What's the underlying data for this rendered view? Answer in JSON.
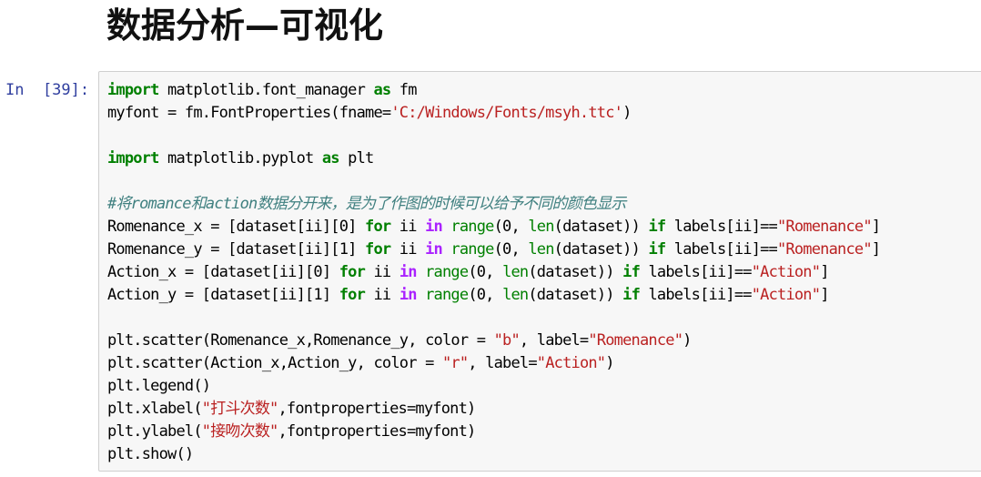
{
  "markdown": {
    "heading": "数据分析—可视化"
  },
  "cell": {
    "prompt": "In  [39]:",
    "lines": [
      [
        {
          "t": "import",
          "c": "kw"
        },
        {
          "t": " matplotlib.font_manager ",
          "c": "tx"
        },
        {
          "t": "as",
          "c": "kw"
        },
        {
          "t": " fm",
          "c": "tx"
        }
      ],
      [
        {
          "t": "myfont = fm.FontProperties(fname=",
          "c": "tx"
        },
        {
          "t": "'C:/Windows/Fonts/msyh.ttc'",
          "c": "str"
        },
        {
          "t": ")",
          "c": "tx"
        }
      ],
      [],
      [
        {
          "t": "import",
          "c": "kw"
        },
        {
          "t": " matplotlib.pyplot ",
          "c": "tx"
        },
        {
          "t": "as",
          "c": "kw"
        },
        {
          "t": " plt",
          "c": "tx"
        }
      ],
      [],
      [
        {
          "t": "#将romance和action数据分开来，是为了作图的时候可以给予不同的颜色显示",
          "c": "cm"
        }
      ],
      [
        {
          "t": "Romenance_x = [dataset[ii][0] ",
          "c": "tx"
        },
        {
          "t": "for",
          "c": "kw"
        },
        {
          "t": " ii ",
          "c": "tx"
        },
        {
          "t": "in",
          "c": "op"
        },
        {
          "t": " ",
          "c": "tx"
        },
        {
          "t": "range",
          "c": "bi"
        },
        {
          "t": "(0, ",
          "c": "tx"
        },
        {
          "t": "len",
          "c": "bi"
        },
        {
          "t": "(dataset)) ",
          "c": "tx"
        },
        {
          "t": "if",
          "c": "kw"
        },
        {
          "t": " labels[ii]==",
          "c": "tx"
        },
        {
          "t": "\"Romenance\"",
          "c": "str"
        },
        {
          "t": "]",
          "c": "tx"
        }
      ],
      [
        {
          "t": "Romenance_y = [dataset[ii][1] ",
          "c": "tx"
        },
        {
          "t": "for",
          "c": "kw"
        },
        {
          "t": " ii ",
          "c": "tx"
        },
        {
          "t": "in",
          "c": "op"
        },
        {
          "t": " ",
          "c": "tx"
        },
        {
          "t": "range",
          "c": "bi"
        },
        {
          "t": "(0, ",
          "c": "tx"
        },
        {
          "t": "len",
          "c": "bi"
        },
        {
          "t": "(dataset)) ",
          "c": "tx"
        },
        {
          "t": "if",
          "c": "kw"
        },
        {
          "t": " labels[ii]==",
          "c": "tx"
        },
        {
          "t": "\"Romenance\"",
          "c": "str"
        },
        {
          "t": "]",
          "c": "tx"
        }
      ],
      [
        {
          "t": "Action_x = [dataset[ii][0] ",
          "c": "tx"
        },
        {
          "t": "for",
          "c": "kw"
        },
        {
          "t": " ii ",
          "c": "tx"
        },
        {
          "t": "in",
          "c": "op"
        },
        {
          "t": " ",
          "c": "tx"
        },
        {
          "t": "range",
          "c": "bi"
        },
        {
          "t": "(0, ",
          "c": "tx"
        },
        {
          "t": "len",
          "c": "bi"
        },
        {
          "t": "(dataset)) ",
          "c": "tx"
        },
        {
          "t": "if",
          "c": "kw"
        },
        {
          "t": " labels[ii]==",
          "c": "tx"
        },
        {
          "t": "\"Action\"",
          "c": "str"
        },
        {
          "t": "]",
          "c": "tx"
        }
      ],
      [
        {
          "t": "Action_y = [dataset[ii][1] ",
          "c": "tx"
        },
        {
          "t": "for",
          "c": "kw"
        },
        {
          "t": " ii ",
          "c": "tx"
        },
        {
          "t": "in",
          "c": "op"
        },
        {
          "t": " ",
          "c": "tx"
        },
        {
          "t": "range",
          "c": "bi"
        },
        {
          "t": "(0, ",
          "c": "tx"
        },
        {
          "t": "len",
          "c": "bi"
        },
        {
          "t": "(dataset)) ",
          "c": "tx"
        },
        {
          "t": "if",
          "c": "kw"
        },
        {
          "t": " labels[ii]==",
          "c": "tx"
        },
        {
          "t": "\"Action\"",
          "c": "str"
        },
        {
          "t": "]",
          "c": "tx"
        }
      ],
      [],
      [
        {
          "t": "plt.scatter(Romenance_x,Romenance_y, color = ",
          "c": "tx"
        },
        {
          "t": "\"b\"",
          "c": "str"
        },
        {
          "t": ", label=",
          "c": "tx"
        },
        {
          "t": "\"Romenance\"",
          "c": "str"
        },
        {
          "t": ")",
          "c": "tx"
        }
      ],
      [
        {
          "t": "plt.scatter(Action_x,Action_y, color = ",
          "c": "tx"
        },
        {
          "t": "\"r\"",
          "c": "str"
        },
        {
          "t": ", label=",
          "c": "tx"
        },
        {
          "t": "\"Action\"",
          "c": "str"
        },
        {
          "t": ")",
          "c": "tx"
        }
      ],
      [
        {
          "t": "plt.legend()",
          "c": "tx"
        }
      ],
      [
        {
          "t": "plt.xlabel(",
          "c": "tx"
        },
        {
          "t": "\"打斗次数\"",
          "c": "str"
        },
        {
          "t": ",fontproperties=myfont)",
          "c": "tx"
        }
      ],
      [
        {
          "t": "plt.ylabel(",
          "c": "tx"
        },
        {
          "t": "\"接吻次数\"",
          "c": "str"
        },
        {
          "t": ",fontproperties=myfont)",
          "c": "tx"
        }
      ],
      [
        {
          "t": "plt.show()",
          "c": "tx"
        }
      ]
    ]
  }
}
